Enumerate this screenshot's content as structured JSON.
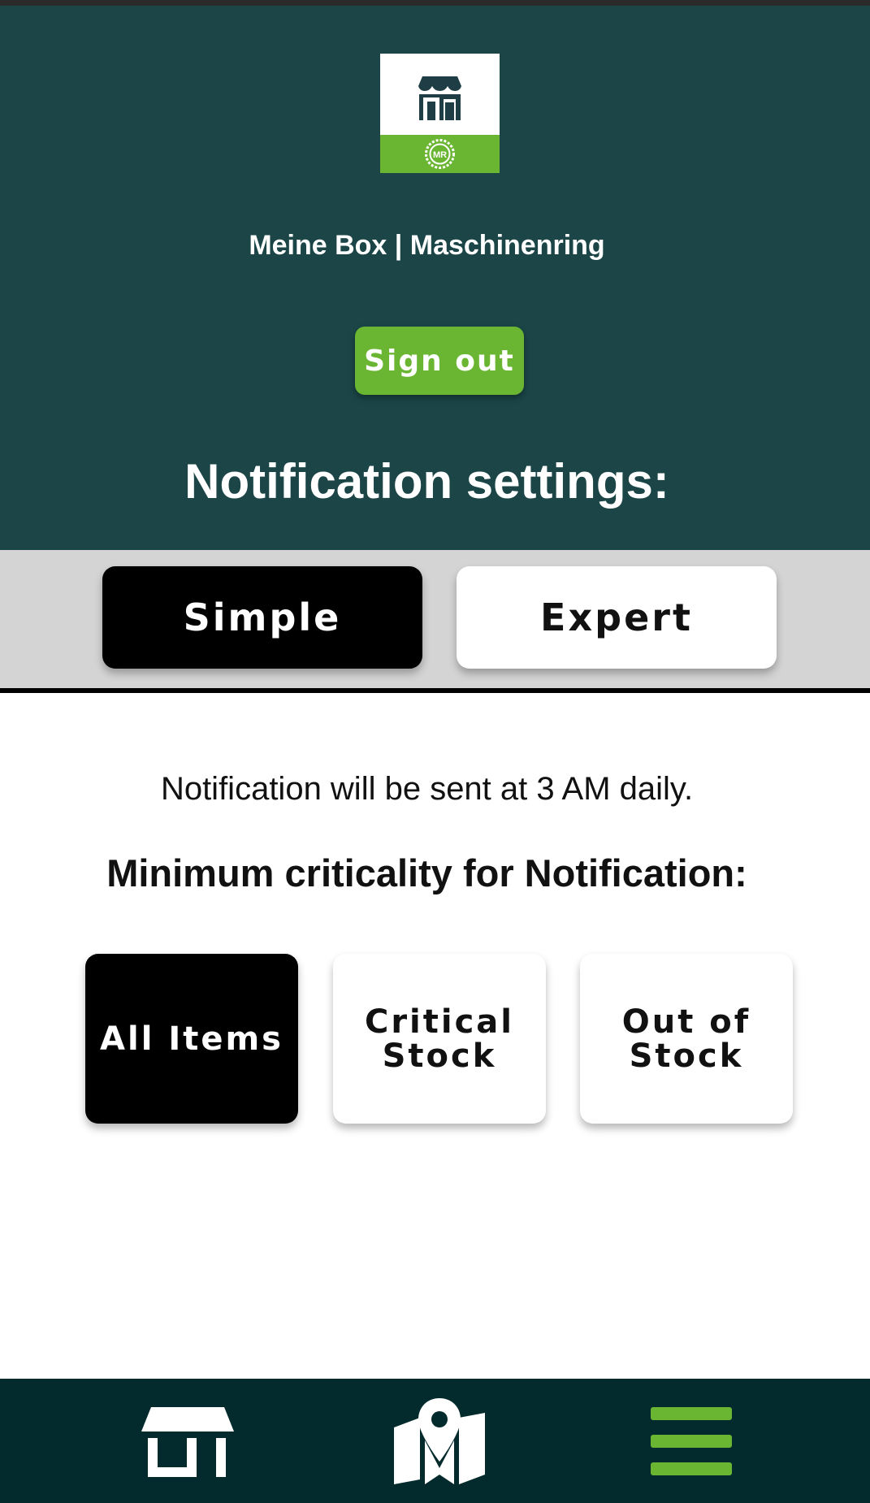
{
  "header": {
    "app_title": "Meine Box | Maschinenring",
    "logo_badge": "MR",
    "signout_label": "Sign out",
    "section_title": "Notification settings:"
  },
  "mode_tabs": {
    "simple_label": "Simple",
    "expert_label": "Expert",
    "selected": "Simple"
  },
  "content": {
    "info_text": "Notification will be sent at 3 AM daily.",
    "criticality_title": "Minimum criticality for Notification:",
    "options": [
      {
        "label": "All Items"
      },
      {
        "label": "Critical Stock"
      },
      {
        "label": "Out of Stock"
      }
    ],
    "selected_option": "All Items"
  },
  "bottom_nav": {
    "items": [
      {
        "icon": "shop-icon"
      },
      {
        "icon": "map-icon"
      },
      {
        "icon": "menu-icon"
      }
    ],
    "active": "menu-icon"
  },
  "colors": {
    "header_bg": "#1b4547",
    "accent_green": "#6ab532",
    "nav_bg": "#032b2d",
    "tab_bar_bg": "#d4d4d4",
    "selected_bg": "#000000"
  }
}
